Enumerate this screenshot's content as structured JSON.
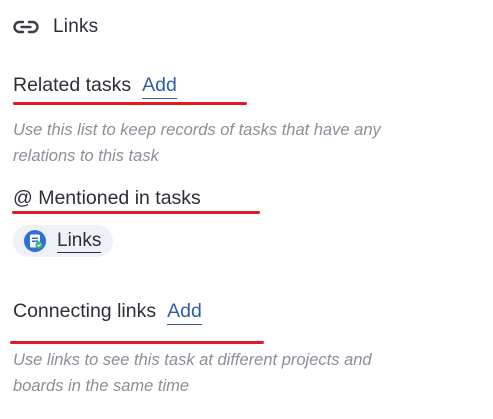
{
  "header": {
    "icon": "link-icon",
    "title": "Links"
  },
  "related_tasks": {
    "title": "Related tasks",
    "add_label": "Add",
    "hint_line1": "Use this list to keep records of tasks that have any",
    "hint_line2": "relations to this task"
  },
  "mentioned": {
    "title": "@ Mentioned in tasks",
    "items": [
      {
        "label": "Links",
        "icon": "task-icon"
      }
    ]
  },
  "connecting_links": {
    "title": "Connecting links",
    "add_label": "Add",
    "hint_line1": "Use links to see this task at different projects and",
    "hint_line2": "boards in the same time"
  },
  "colors": {
    "accent_link": "#2f5ea8",
    "annotation_red": "#e01b24",
    "hint_text": "#8a8f98",
    "chip_bg": "#eef1f7"
  }
}
